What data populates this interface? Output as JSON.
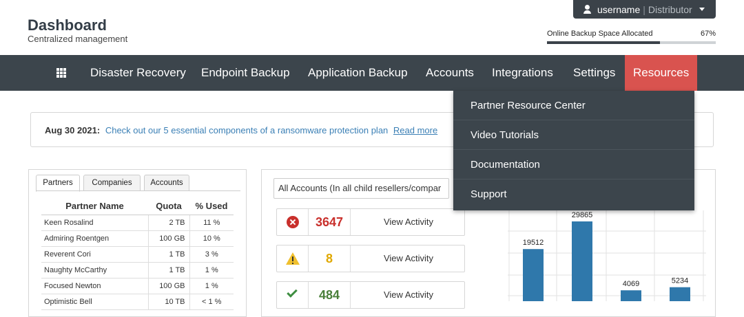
{
  "header": {
    "title": "Dashboard",
    "subtitle": "Centralized management",
    "user": {
      "name": "username",
      "separator": "|",
      "role": "Distributor"
    },
    "backup": {
      "label": "Online Backup Space Allocated",
      "percent_label": "67%",
      "percent": 67
    }
  },
  "nav": {
    "items": [
      "Disaster Recovery",
      "Endpoint Backup",
      "Application Backup",
      "Accounts",
      "Integrations",
      "Settings",
      "Resources"
    ],
    "active": "Resources"
  },
  "dropdown": {
    "items": [
      "Partner Resource Center",
      "Video Tutorials",
      "Documentation",
      "Support"
    ]
  },
  "announcement": {
    "date": "Aug 30 2021:",
    "text": "Check out our 5 essential components of a ransomware protection plan",
    "link": "Read more"
  },
  "partners": {
    "tabs": [
      "Partners",
      "Companies",
      "Accounts"
    ],
    "active_tab": "Partners",
    "columns": [
      "Partner Name",
      "Quota",
      "% Used"
    ],
    "rows": [
      {
        "name": "Keen Rosalind",
        "quota": "2 TB",
        "used": "11 %"
      },
      {
        "name": "Admiring Roentgen",
        "quota": "100 GB",
        "used": "10 %"
      },
      {
        "name": "Reverent Cori",
        "quota": "1 TB",
        "used": "3 %"
      },
      {
        "name": "Naughty McCarthy",
        "quota": "1 TB",
        "used": "1 %"
      },
      {
        "name": "Focused Newton",
        "quota": "100 GB",
        "used": "1 %"
      },
      {
        "name": "Optimistic Bell",
        "quota": "10 TB",
        "used": "< 1 %"
      }
    ]
  },
  "activity": {
    "filter": "All Accounts (In all child resellers/compar",
    "stats": [
      {
        "icon": "error-icon",
        "count": "3647",
        "color": "#c9302c",
        "view": "View Activity"
      },
      {
        "icon": "warning-icon",
        "count": "8",
        "color": "#e0a800",
        "view": "View Activity"
      },
      {
        "icon": "check-icon",
        "count": "484",
        "color": "#4a7f3a",
        "view": "View Activity"
      }
    ]
  },
  "chart_data": {
    "type": "bar",
    "values": [
      19512,
      29865,
      4069,
      5234
    ],
    "value_labels": [
      "19512",
      "29865",
      "4069",
      "5234"
    ],
    "bar_color": "#2f78ab",
    "grid": true
  }
}
